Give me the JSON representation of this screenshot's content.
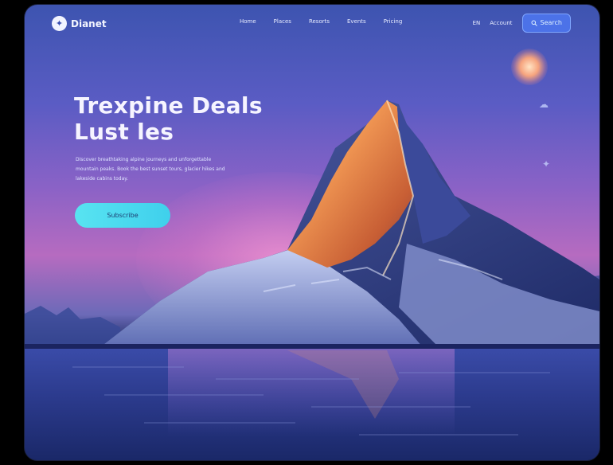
{
  "header": {
    "logo_mark": "✦",
    "logo_text": "Dianet",
    "nav_links": [
      "Home",
      "Places",
      "Resorts",
      "Events",
      "Pricing"
    ],
    "language": "EN",
    "account": "Account",
    "cta_icon": "search-icon",
    "cta_label": "Search"
  },
  "hero": {
    "title_line1": "Trexpine Deals",
    "title_line2": "Lust les",
    "body": "Discover breathtaking alpine journeys and unforgettable mountain peaks. Book the best sunset tours, glacier hikes and lakeside cabins today.",
    "button_label": "Subscribe"
  },
  "side_icons": [
    "cloud-icon",
    "compass-icon"
  ],
  "colors": {
    "accent": "#4c72e8",
    "button": "#4fddef",
    "sky_top": "#3d54b0",
    "glow": "#f496d2"
  }
}
